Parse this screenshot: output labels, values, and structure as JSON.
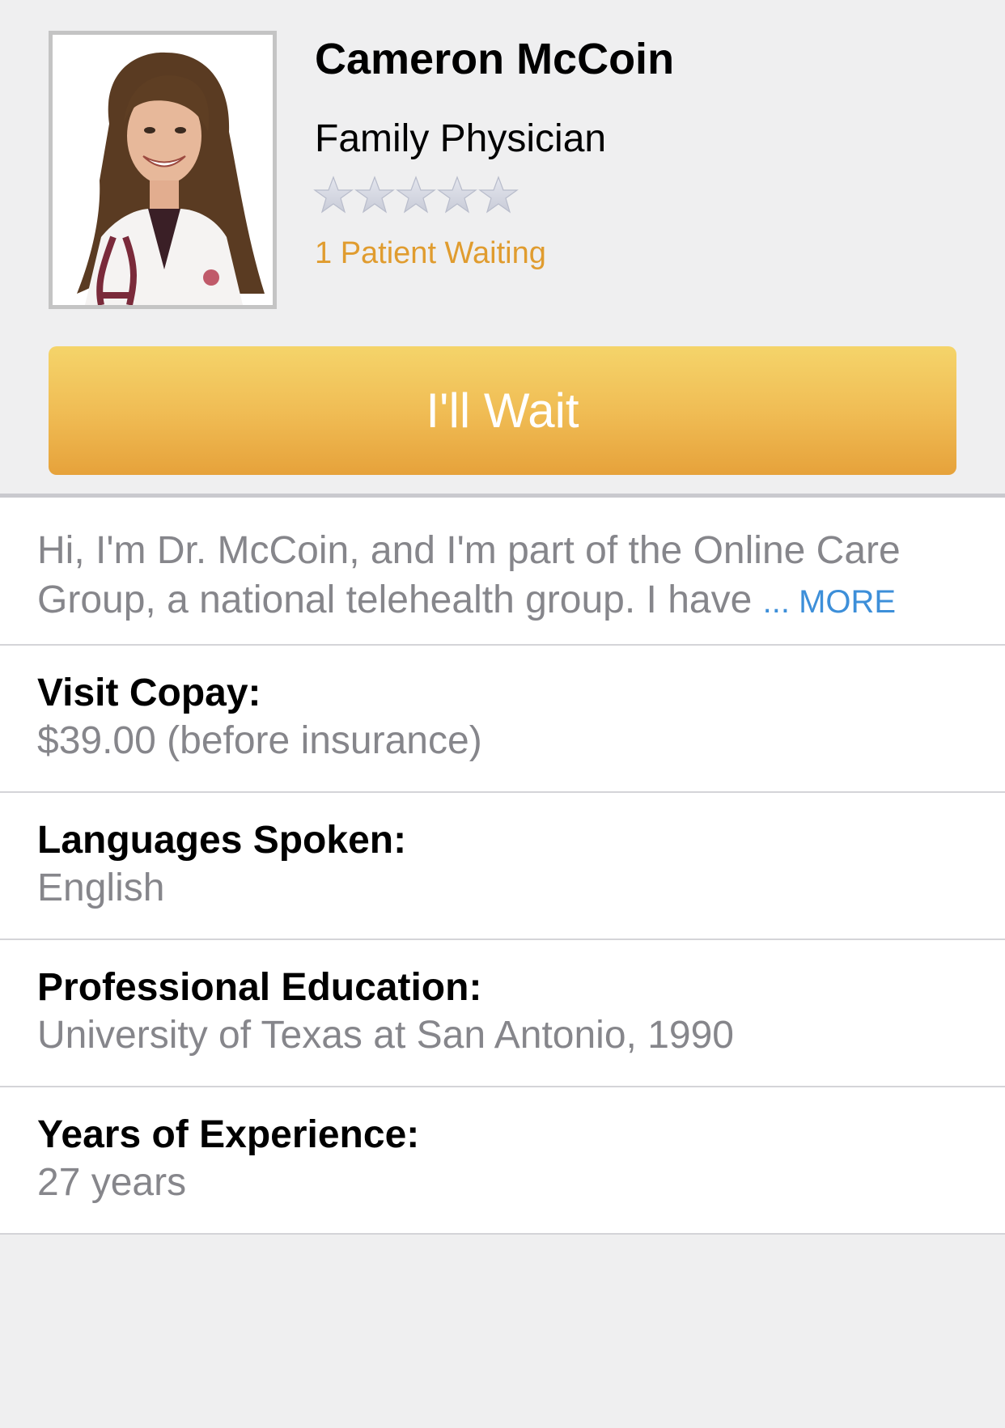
{
  "doctor": {
    "name": "Cameron McCoin",
    "specialty": "Family Physician",
    "rating": 0,
    "rating_max": 5,
    "patients_waiting": "1 Patient Waiting",
    "photo_icon": "doctor-portrait"
  },
  "actions": {
    "wait_label": "I'll Wait"
  },
  "bio": {
    "text": "Hi, I'm Dr. McCoin, and I'm part of the Online Care Group, a national telehealth group. I have",
    "more_label": "... MORE"
  },
  "details": [
    {
      "label": "Visit Copay:",
      "value": "$39.00 (before insurance)"
    },
    {
      "label": "Languages Spoken:",
      "value": "English"
    },
    {
      "label": "Professional Education:",
      "value": "University of Texas at San Antonio, 1990"
    },
    {
      "label": "Years of Experience:",
      "value": "27 years"
    }
  ],
  "colors": {
    "accent_orange": "#e09c2f",
    "button_top": "#f5d46a",
    "button_bottom": "#e6a23b",
    "link_blue": "#3d8fd9",
    "secondary_text": "#86868b",
    "background": "#efeff0"
  }
}
